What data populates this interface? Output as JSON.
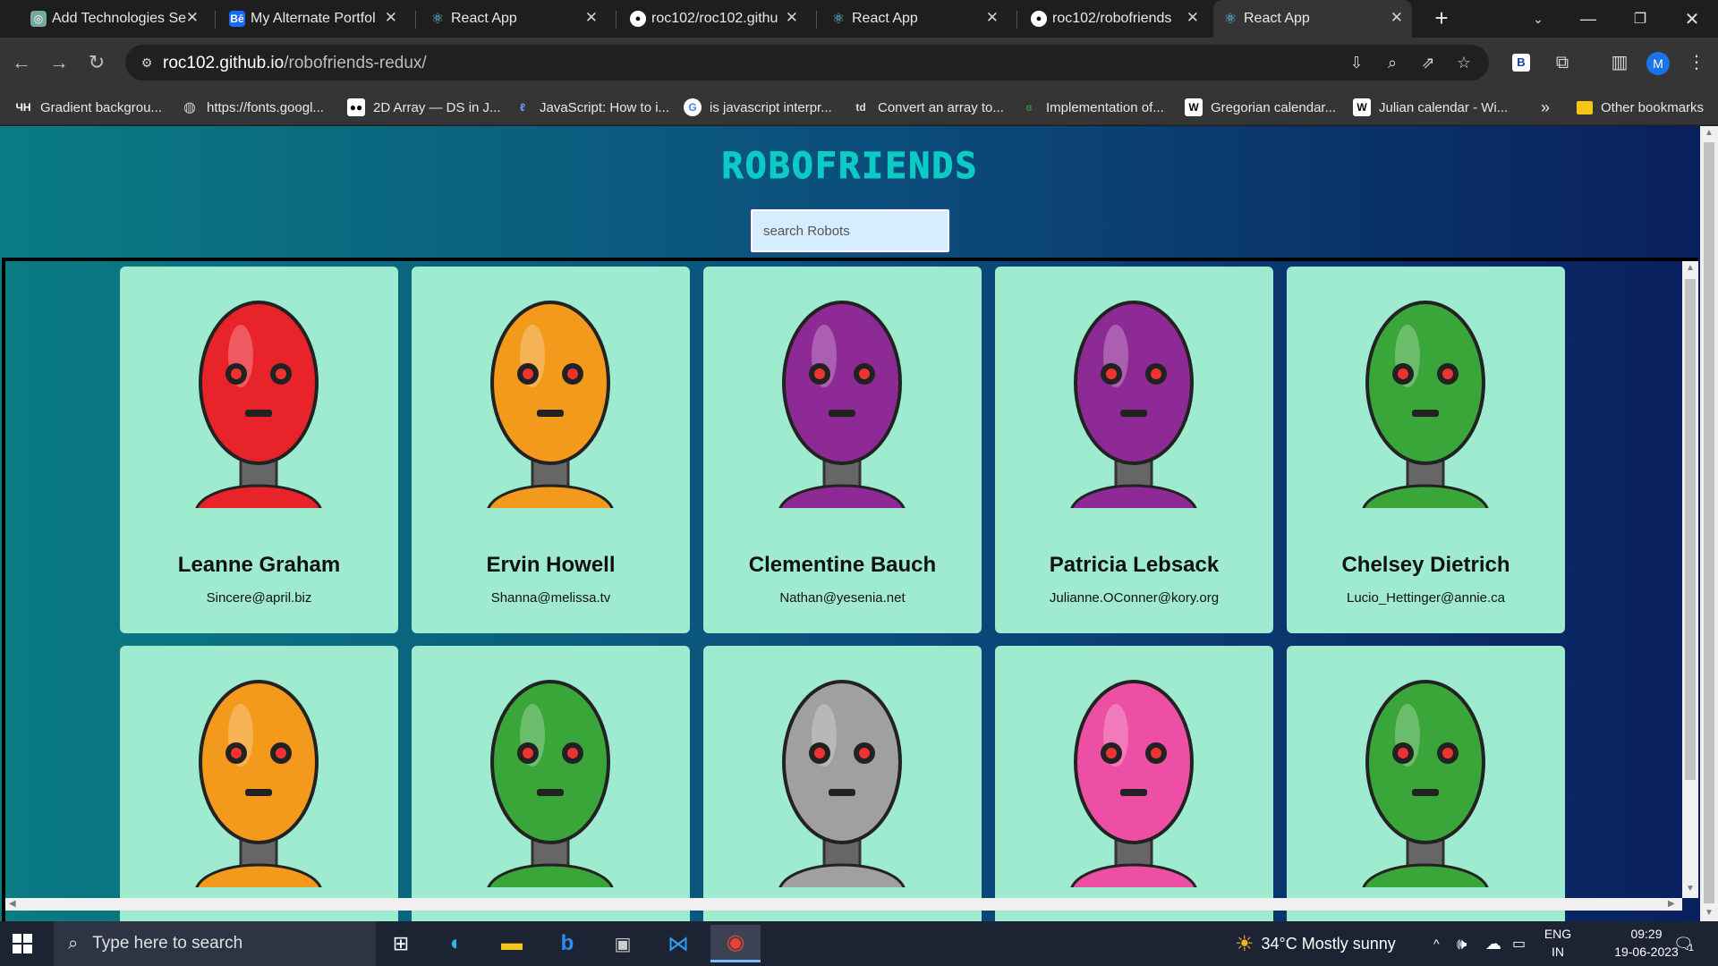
{
  "browser": {
    "tabs": [
      {
        "title": "Add Technologies Se",
        "icon": "chatgpt-icon"
      },
      {
        "title": "My Alternate Portfol",
        "icon": "behance-icon"
      },
      {
        "title": "React App",
        "icon": "react-icon"
      },
      {
        "title": "roc102/roc102.githu",
        "icon": "github-icon"
      },
      {
        "title": "React App",
        "icon": "react-icon"
      },
      {
        "title": "roc102/robofriends",
        "icon": "github-icon"
      },
      {
        "title": "React App",
        "icon": "react-icon",
        "active": true
      }
    ],
    "url_host": "roc102.github.io",
    "url_path": "/robofriends-redux/",
    "profile_initial": "M",
    "bookmarks": [
      {
        "label": "Gradient backgrou...",
        "icon": "uh-icon"
      },
      {
        "label": "https://fonts.googl...",
        "icon": "globe-icon"
      },
      {
        "label": "2D Array — DS in J...",
        "icon": "medium-icon"
      },
      {
        "label": "JavaScript: How to i...",
        "icon": "page-icon"
      },
      {
        "label": "is javascript interpr...",
        "icon": "google-icon"
      },
      {
        "label": "Convert an array to...",
        "icon": "td-icon"
      },
      {
        "label": "Implementation of...",
        "icon": "gfg-icon"
      },
      {
        "label": "Gregorian calendar...",
        "icon": "wikipedia-icon"
      },
      {
        "label": "Julian calendar - Wi...",
        "icon": "wikipedia-icon"
      }
    ],
    "more_bookmarks": "»",
    "other_bookmarks": "Other bookmarks"
  },
  "page": {
    "logo": "ROBOFRIENDS",
    "search_placeholder": "search Robots",
    "robots": [
      {
        "name": "Leanne Graham",
        "email": "Sincere@april.biz",
        "color": "#e8232a"
      },
      {
        "name": "Ervin Howell",
        "email": "Shanna@melissa.tv",
        "color": "#f39a1c"
      },
      {
        "name": "Clementine Bauch",
        "email": "Nathan@yesenia.net",
        "color": "#8e2a96"
      },
      {
        "name": "Patricia Lebsack",
        "email": "Julianne.OConner@kory.org",
        "color": "#8e2a96"
      },
      {
        "name": "Chelsey Dietrich",
        "email": "Lucio_Hettinger@annie.ca",
        "color": "#3aa63a"
      },
      {
        "name": "",
        "email": "",
        "color": "#f39a1c"
      },
      {
        "name": "",
        "email": "",
        "color": "#3aa63a"
      },
      {
        "name": "",
        "email": "",
        "color": "#a0a0a0"
      },
      {
        "name": "",
        "email": "",
        "color": "#ec4fa3"
      },
      {
        "name": "",
        "email": "",
        "color": "#3aa63a"
      }
    ]
  },
  "taskbar": {
    "search_placeholder": "Type here to search",
    "weather": "34°C  Mostly sunny",
    "lang_top": "ENG",
    "lang_bottom": "IN",
    "time": "09:29",
    "date": "19-06-2023",
    "notifications": "1"
  }
}
